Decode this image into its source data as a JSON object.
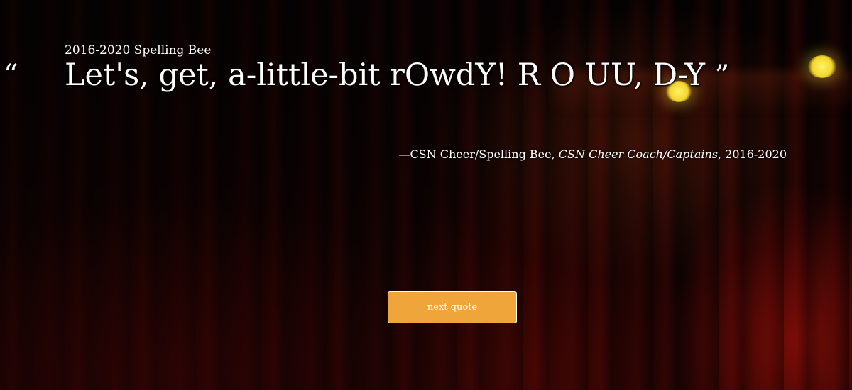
{
  "header": {
    "subtitle": "2016-2020 Spelling Bee"
  },
  "quote": {
    "open_mark": "“",
    "text": "Let's, get, a-little-bit rOwdY! R O UU, D-Y",
    "close_mark": "”"
  },
  "attribution": {
    "author": "—CSN Cheer/Spelling Bee, ",
    "source": "CSN Cheer Coach/Captains",
    "year": ", 2016-2020"
  },
  "actions": {
    "next_label": "next quote"
  },
  "colors": {
    "button": "#f0a53a",
    "text": "#ffffff",
    "background": "#000000"
  }
}
